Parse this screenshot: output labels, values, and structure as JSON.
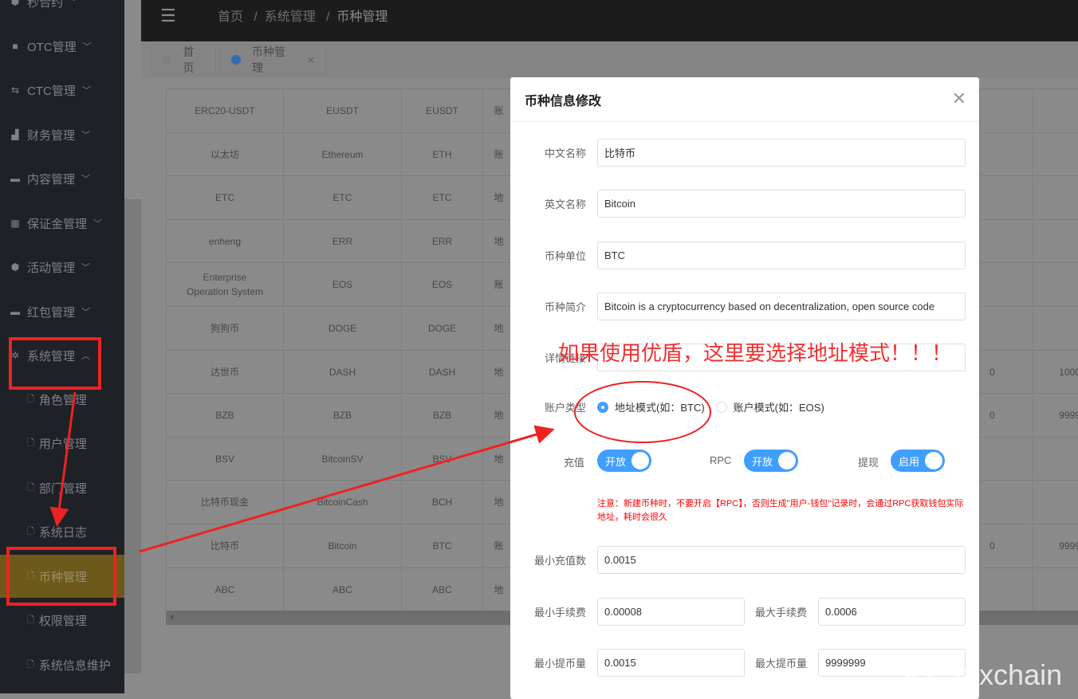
{
  "sidebar": {
    "items": [
      {
        "label": "秒合约",
        "icon": "cube-icon"
      },
      {
        "label": "OTC管理",
        "icon": "briefcase-icon"
      },
      {
        "label": "CTC管理",
        "icon": "exchange-icon"
      },
      {
        "label": "财务管理",
        "icon": "bar-chart-icon"
      },
      {
        "label": "内容管理",
        "icon": "folder-icon"
      },
      {
        "label": "保证金管理",
        "icon": "grid-icon"
      },
      {
        "label": "活动管理",
        "icon": "cube-icon"
      },
      {
        "label": "红包管理",
        "icon": "wallet-icon"
      },
      {
        "label": "系统管理",
        "icon": "gear-icon"
      }
    ],
    "subitems": [
      "角色管理",
      "用户管理",
      "部门管理",
      "系统日志",
      "币种管理",
      "权限管理",
      "系统信息维护"
    ],
    "active": "币种管理"
  },
  "header": {
    "breadcrumb": [
      "首页",
      "系统管理",
      "币种管理"
    ]
  },
  "tabs": [
    {
      "label": "首页",
      "dot": "#8f9696"
    },
    {
      "label": "币种管理",
      "dot": "#2f6fb0"
    }
  ],
  "table": {
    "rows": [
      [
        "ERC20-USDT",
        "EUSDT",
        "EUSDT",
        "账"
      ],
      [
        "以太坊",
        "Ethereum",
        "ETH",
        "账"
      ],
      [
        "ETC",
        "ETC",
        "ETC",
        "地"
      ],
      [
        "enheng",
        "ERR",
        "ERR",
        "地"
      ],
      [
        "Enterprise Operation System",
        "EOS",
        "EOS",
        "账"
      ],
      [
        "狗狗币",
        "DOGE",
        "DOGE",
        "地"
      ],
      [
        "达世币",
        "DASH",
        "DASH",
        "地"
      ],
      [
        "BZB",
        "BZB",
        "BZB",
        "地"
      ],
      [
        "BSV",
        "BitcoinSV",
        "BSV",
        "地"
      ],
      [
        "比特币现金",
        "BitcoinCash",
        "BCH",
        "地"
      ],
      [
        "比特币",
        "Bitcoin",
        "BTC",
        "账"
      ],
      [
        "ABC",
        "ABC",
        "ABC",
        "地"
      ]
    ],
    "right_values": {
      "6": [
        "0",
        "1000"
      ],
      "7": [
        "0",
        "9999"
      ],
      "10": [
        "0",
        "9999"
      ]
    }
  },
  "modal": {
    "title": "币种信息修改",
    "fields": [
      {
        "label": "中文名称",
        "value": "比特币"
      },
      {
        "label": "英文名称",
        "value": "Bitcoin"
      },
      {
        "label": "币种单位",
        "value": "BTC"
      },
      {
        "label": "币种简介",
        "value": "Bitcoin is a cryptocurrency based on decentralization, open source code"
      },
      {
        "label": "详情链接",
        "value": ""
      }
    ],
    "account_type": {
      "label": "账户类型",
      "options": [
        "地址模式(如：BTC)",
        "账户模式(如：EOS)"
      ],
      "selected": 0
    },
    "switches": [
      {
        "label": "充值",
        "text": "开放",
        "on": true
      },
      {
        "label": "RPC",
        "text": "开放",
        "on": true
      },
      {
        "label": "提现",
        "text": "启用",
        "on": true
      }
    ],
    "note": "注意：新建币种时，不要开启【RPC】，否则生成\"用户-钱包\"记录时，会通过RPC获取钱包实际地址，耗时会很久",
    "min_recharge": {
      "label": "最小充值数",
      "value": "0.0015"
    },
    "min_fee": {
      "label": "最小手续费",
      "value": "0.00008"
    },
    "max_fee": {
      "label": "最大手续费",
      "value": "0.0006"
    },
    "min_withdraw": {
      "label": "最小提币量",
      "value": "0.0015"
    },
    "max_withdraw": {
      "label": "最大提币量",
      "value": "9999999"
    }
  },
  "annotation": {
    "text": "如果使用优盾，这里要选择地址模式！！！",
    "color": "#ee2222"
  },
  "watermark": "VX: btxchain"
}
